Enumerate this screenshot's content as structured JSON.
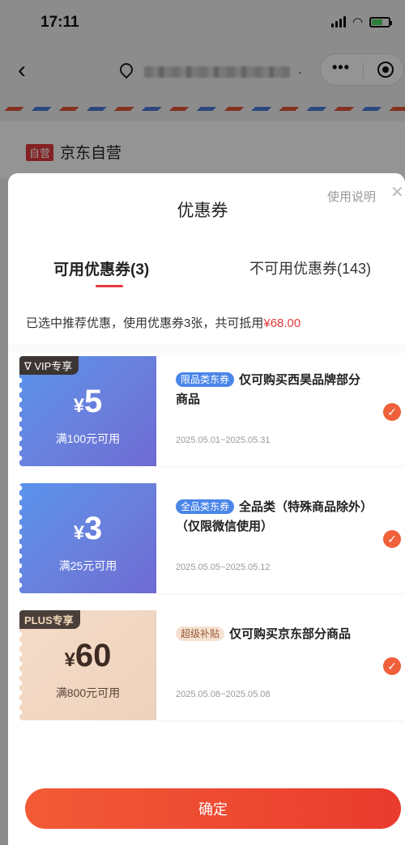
{
  "status_bar": {
    "time": "17:11"
  },
  "nav": {
    "address_suffix": "."
  },
  "store": {
    "badge": "自营",
    "name": "京东自营"
  },
  "sheet": {
    "title": "优惠券",
    "help_label": "使用说明",
    "close_label": "✕",
    "tabs": [
      {
        "label": "可用优惠券(3)",
        "active": true
      },
      {
        "label": "不可用优惠券(143)",
        "active": false
      }
    ],
    "summary_prefix": "已选中推荐优惠，使用优惠券3张，共可抵用",
    "summary_amount": "¥68.00",
    "coupons": [
      {
        "tag": "VIP专享",
        "currency": "¥",
        "amount": "5",
        "condition": "满100元可用",
        "type_label": "限品类东券",
        "description": "仅可购买西昊品牌部分商品",
        "validity": "2025.05.01~2025.05.31",
        "selected": true,
        "theme": "blue"
      },
      {
        "tag": "",
        "currency": "¥",
        "amount": "3",
        "condition": "满25元可用",
        "type_label": "全品类东券",
        "description": "全品类（特殊商品除外）（仅限微信使用）",
        "validity": "2025.05.05~2025.05.12",
        "selected": true,
        "theme": "blue"
      },
      {
        "tag": "PLUS专享",
        "currency": "¥",
        "amount": "60",
        "condition": "满800元可用",
        "type_label": "超级补贴",
        "description": "仅可购买京东部分商品",
        "validity": "2025.05.08~2025.05.08",
        "selected": true,
        "theme": "peach"
      }
    ],
    "confirm_label": "确定"
  },
  "colors": {
    "accent_red": "#e4393c",
    "check_orange": "#f0603a",
    "coupon_blue": "#5a93ec",
    "coupon_peach": "#f4dcc8"
  }
}
